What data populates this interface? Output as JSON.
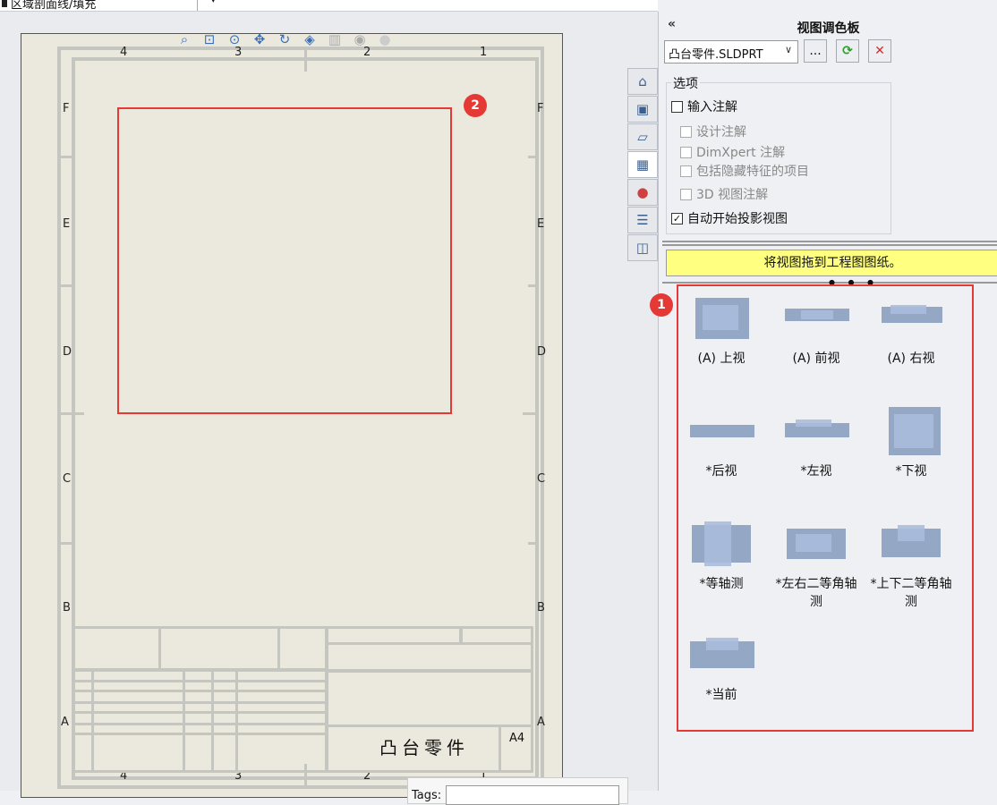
{
  "toolbar": {
    "partial_label": "区域剖面线/填充",
    "dropdown": "▾"
  },
  "sheet": {
    "zones_top": [
      "4",
      "3",
      "2",
      "1"
    ],
    "zones_bottom": [
      "4",
      "3",
      "2",
      "1"
    ],
    "zones_left": [
      "F",
      "E",
      "D",
      "C",
      "B",
      "A"
    ],
    "zones_right": [
      "F",
      "E",
      "D",
      "C",
      "B",
      "A"
    ],
    "part_title": "凸台零件",
    "sheet_size": "A4"
  },
  "markers": {
    "views": "1",
    "drop_area": "2"
  },
  "tags": {
    "label": "Tags:"
  },
  "panel": {
    "title": "视图调色板",
    "collapse": "«",
    "doc_select": "凸台零件.SLDPRT",
    "browse_label": "...",
    "refresh_icon": "⟳",
    "close_icon": "✕",
    "options_title": "选项",
    "options": [
      {
        "label": "输入注解",
        "checked": false,
        "enabled": true
      },
      {
        "label": "设计注解",
        "checked": false,
        "enabled": false
      },
      {
        "label": "DimXpert 注解",
        "checked": false,
        "enabled": false
      },
      {
        "label": "包括隐藏特征的项目",
        "checked": false,
        "enabled": false
      },
      {
        "label": "3D 视图注解",
        "checked": false,
        "enabled": false
      },
      {
        "label": "自动开始投影视图",
        "checked": true,
        "enabled": true
      }
    ],
    "hint": "将视图拖到工程图图纸。",
    "views": [
      {
        "label": "(A) 上视"
      },
      {
        "label": "(A) 前视"
      },
      {
        "label": "(A) 右视"
      },
      {
        "label": "*后视"
      },
      {
        "label": "*左视"
      },
      {
        "label": "*下视"
      },
      {
        "label": "*等轴测"
      },
      {
        "label": "*左右二等角轴测"
      },
      {
        "label": "*上下二等角轴测"
      },
      {
        "label": "*当前"
      }
    ]
  },
  "side_tabs": [
    "home-icon",
    "3d-parts-icon",
    "folder-icon",
    "view-palette-icon",
    "appearance-icon",
    "custom-properties-icon",
    "forum-icon"
  ],
  "colors": {
    "highlight": "#e53935",
    "hint_bg": "#ffff80",
    "sheet_bg": "#ebe9de"
  }
}
